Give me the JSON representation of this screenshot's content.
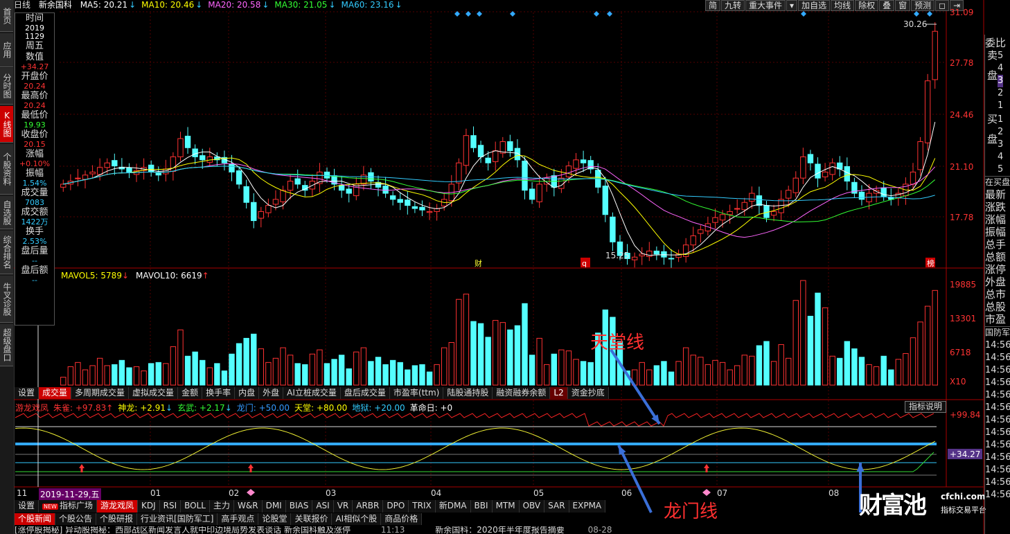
{
  "window": {
    "chart_type_label": "日线",
    "stock_name": "新余国科"
  },
  "ma_legend": [
    {
      "label": "MA5: 20.21",
      "arrow": "↓",
      "color": "#ffffff"
    },
    {
      "label": "MA10: 20.46",
      "arrow": "↓",
      "color": "#ffff00"
    },
    {
      "label": "MA20: 20.58",
      "arrow": "↓",
      "color": "#ff66ff"
    },
    {
      "label": "MA30: 21.05",
      "arrow": "↓",
      "color": "#33ff33"
    },
    {
      "label": "MA60: 23.16",
      "arrow": "↓",
      "color": "#33ccff"
    }
  ],
  "toolbar": [
    "简",
    "九转",
    "重大事件",
    "▾",
    "加自选",
    "均线",
    "除权",
    "叠",
    "窗",
    "预测",
    "◻",
    "⇥"
  ],
  "left_nav": [
    {
      "label": "首页",
      "active": false
    },
    {
      "label": "应用",
      "active": false
    },
    {
      "label": "分时图",
      "active": false
    },
    {
      "label": "K线图",
      "active": true
    },
    {
      "label": "个股资料",
      "active": false
    },
    {
      "label": "自选股",
      "active": false
    },
    {
      "label": "综合排名",
      "active": false
    },
    {
      "label": "牛叉诊股",
      "active": false
    },
    {
      "label": "超级盘口",
      "active": false
    }
  ],
  "info_panel": [
    {
      "label": "时间",
      "value": "2019",
      "color": "white"
    },
    {
      "label": "",
      "value": "1129",
      "color": "white"
    },
    {
      "label": "周五",
      "value": "",
      "color": "white"
    },
    {
      "label": "数值",
      "value": "+34.27",
      "color": "red"
    },
    {
      "label": "开盘价",
      "value": "20.24",
      "color": "red"
    },
    {
      "label": "最高价",
      "value": "20.24",
      "color": "red"
    },
    {
      "label": "最低价",
      "value": "19.93",
      "color": "green"
    },
    {
      "label": "收盘价",
      "value": "20.15",
      "color": "red"
    },
    {
      "label": "涨幅",
      "value": "+0.10%",
      "color": "red"
    },
    {
      "label": "振幅",
      "value": "1.54%",
      "color": "cyan"
    },
    {
      "label": "成交量",
      "value": "7083",
      "color": "cyan"
    },
    {
      "label": "成交额",
      "value": "1422万",
      "color": "cyan"
    },
    {
      "label": "换手",
      "value": "2.53%",
      "color": "cyan"
    },
    {
      "label": "盘后量",
      "value": "--",
      "color": "cyan"
    },
    {
      "label": "盘后额",
      "value": "--",
      "color": "cyan"
    }
  ],
  "price_axis": [
    "31.09",
    "27.78",
    "24.46",
    "21.10",
    "17.78"
  ],
  "volume_axis": [
    "19885",
    "13301",
    "6718",
    "X10"
  ],
  "indicator_axis": [
    "+99.84",
    "+34.27"
  ],
  "price_annotations": {
    "high_label": "30.26",
    "low_label": "15.25",
    "markers": [
      "财",
      "q",
      "榜"
    ]
  },
  "volume_legend": [
    {
      "label": "MAVOL5: 5789",
      "arrow": "↓",
      "color": "#ffff00"
    },
    {
      "label": "MAVOL10: 6619",
      "arrow": "↑",
      "color": "#ffffff"
    }
  ],
  "volume_tabs": [
    "设置",
    "成交量",
    "多周期成交量",
    "虚拟成交量",
    "金额",
    "换手率",
    "内盘",
    "外盘",
    "AI立桩成交量",
    "盘后成交量",
    "市盈率(ttm)",
    "陆股通持股",
    "融资融券余额",
    "L2",
    "资金抄底"
  ],
  "indicator_legend": [
    {
      "label": "游龙戏凤",
      "color": "#ff3333"
    },
    {
      "label": "朱雀: +97.83",
      "arrow": "↑",
      "color": "#ff3333"
    },
    {
      "label": "神龙: +2.91",
      "arrow": "↓",
      "color": "#ffff00"
    },
    {
      "label": "玄武: +2.17",
      "arrow": "↓",
      "color": "#33ff33"
    },
    {
      "label": "龙门: +50.00",
      "arrow": "",
      "color": "#3399ff"
    },
    {
      "label": "天堂: +80.00",
      "arrow": "",
      "color": "#ffff00"
    },
    {
      "label": "地狱: +20.00",
      "arrow": "",
      "color": "#33ccff"
    },
    {
      "label": "革命日: +0",
      "arrow": "",
      "color": "#ffffff"
    }
  ],
  "indicator_button": "指标说明",
  "annotations": {
    "tiantang": "天堂线",
    "longmen": "龙门线"
  },
  "time_axis": {
    "left_label": "11",
    "cursor_label": "2019-11-29,五",
    "months": [
      "01",
      "02",
      "03",
      "04",
      "05",
      "06",
      "07",
      "08"
    ]
  },
  "indicator_tabs": [
    "设置",
    "指标广场",
    "游龙戏凤",
    "KDJ",
    "RSI",
    "BOLL",
    "主力",
    "W&R",
    "DMI",
    "BIAS",
    "ASI",
    "VR",
    "ARBR",
    "DPO",
    "TRIX",
    "新DMA",
    "BBI",
    "MTM",
    "OBV",
    "SAR",
    "EXPMA"
  ],
  "news_tabs": [
    "个股新闻",
    "个股公告",
    "个股研报",
    "行业资讯[国防军工]",
    "高手观点",
    "论股堂",
    "关联报价",
    "AI相似个股",
    "商品价格"
  ],
  "news_ticker": "[涨停股揭秘] 异动股揭秘：西部战区新闻发言人就中印边境局势发表谈话 新余国科触及涨停",
  "news_right": "新余国科：2020年半年度报告摘要",
  "news_time": "11:13",
  "news_time_right": "08-28",
  "order_book": {
    "header": "委比",
    "sell_label": "卖盘",
    "sell": [
      "5",
      "4",
      "3",
      "2",
      "1"
    ],
    "buy_label": "买盘",
    "buy": [
      "1",
      "2",
      "3",
      "4",
      "5"
    ],
    "in_buy": "在买盘",
    "stats": [
      "最新",
      "涨跌",
      "涨幅",
      "振幅",
      "总手",
      "总额",
      "涨停",
      "外盘",
      "总市",
      "总股",
      "市盈"
    ],
    "ticker_header": "国防军",
    "ticker_times": [
      "14:56",
      "14:56",
      "14:56",
      "14:56",
      "14:56",
      "14:56",
      "14:56",
      "14:56",
      "14:56",
      "14:56",
      "14:56",
      "14:56",
      "14:56"
    ]
  },
  "watermark": {
    "brand": "财富池",
    "url": "cfchi.com",
    "tagline": "指标交易平台"
  },
  "chart_data": {
    "type": "candlestick",
    "price_ylim": [
      15.0,
      31.5
    ],
    "closes": [
      20.2,
      20.4,
      20.6,
      20.8,
      21.0,
      21.3,
      21.6,
      21.4,
      21.2,
      21.0,
      21.1,
      21.3,
      21.0,
      20.8,
      21.2,
      22.0,
      23.2,
      22.6,
      22.0,
      21.8,
      22.0,
      21.8,
      21.6,
      21.0,
      20.2,
      19.0,
      17.8,
      18.4,
      18.8,
      19.2,
      19.8,
      20.4,
      20.2,
      19.8,
      20.4,
      21.0,
      20.6,
      20.2,
      19.8,
      19.6,
      20.2,
      20.8,
      20.4,
      20.0,
      19.6,
      19.2,
      19.0,
      18.8,
      18.6,
      18.5,
      18.4,
      18.6,
      19.2,
      20.2,
      21.6,
      23.4,
      22.6,
      22.0,
      21.6,
      22.4,
      23.0,
      22.4,
      21.8,
      19.8,
      19.2,
      20.2,
      20.6,
      20.0,
      20.6,
      21.4,
      21.8,
      21.6,
      21.2,
      20.0,
      18.2,
      16.4,
      15.5,
      15.3,
      15.4,
      15.6,
      15.8,
      15.6,
      15.4,
      15.3,
      15.6,
      16.2,
      16.8,
      17.2,
      17.6,
      18.0,
      18.2,
      18.4,
      18.6,
      19.0,
      19.6,
      18.8,
      18.0,
      18.4,
      19.2,
      19.8,
      20.6,
      22.0,
      21.6,
      20.6,
      21.0,
      21.6,
      21.2,
      20.4,
      19.6,
      19.2,
      19.6,
      19.8,
      19.4,
      19.2,
      19.6,
      20.2,
      21.0,
      23.0,
      27.0,
      30.26
    ]
  }
}
